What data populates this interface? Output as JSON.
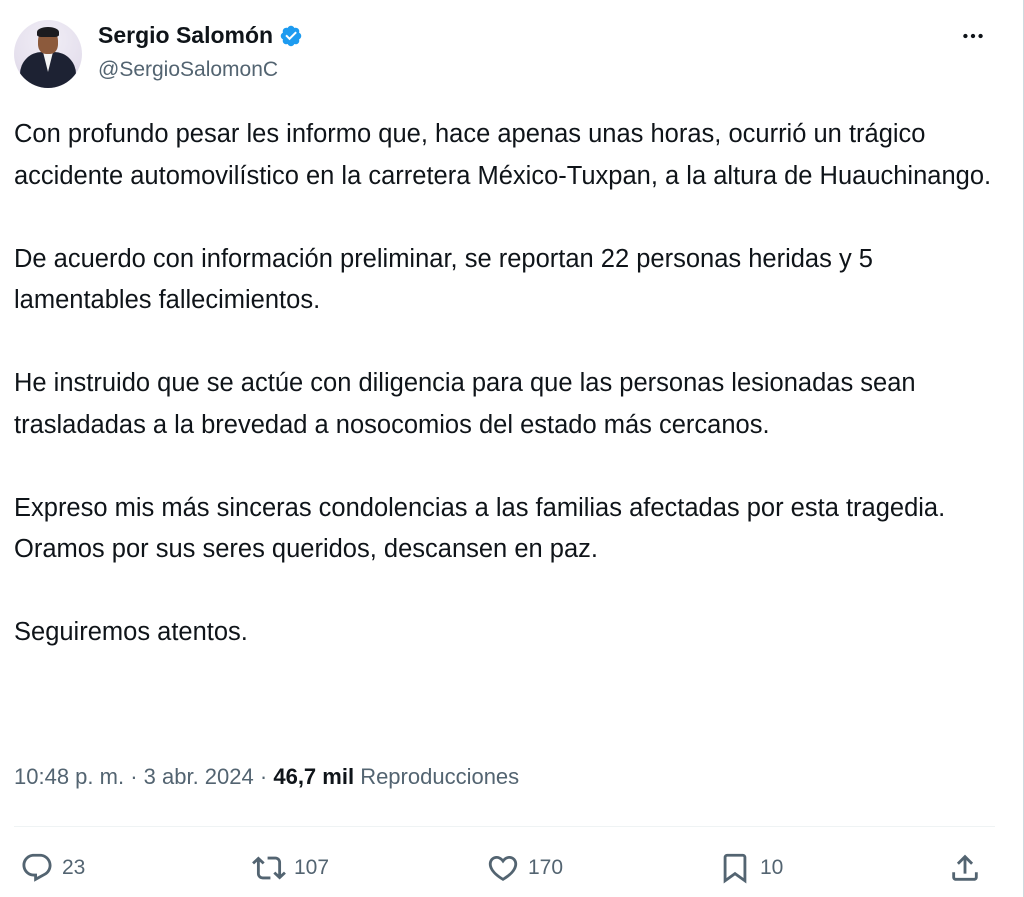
{
  "user": {
    "display_name": "Sergio Salomón",
    "handle": "@SergioSalomonC",
    "verified": true
  },
  "tweet": {
    "paragraphs": [
      "Con profundo pesar les informo que, hace apenas unas horas, ocurrió un trágico accidente automovilístico en la carretera México-Tuxpan, a la altura de Huauchinango.",
      "De acuerdo con información preliminar, se reportan 22 personas heridas y 5 lamentables fallecimientos.",
      "He instruido que se actúe con diligencia para que las personas lesionadas sean trasladadas a la brevedad a nosocomios del estado más cercanos.",
      "Expreso mis más sinceras condolencias a las familias afectadas por esta tragedia. Oramos por sus seres queridos, descansen en paz.",
      "Seguiremos atentos."
    ]
  },
  "meta": {
    "time": "10:48 p. m.",
    "separator": "·",
    "date": "3 abr. 2024",
    "views_count": "46,7 mil",
    "views_label": "Reproducciones"
  },
  "actions": {
    "replies": "23",
    "reposts": "107",
    "likes": "170",
    "bookmarks": "10"
  },
  "icons": {
    "verified": "verified-badge-icon",
    "more": "more-options-icon",
    "reply": "reply-icon",
    "repost": "repost-icon",
    "like": "heart-icon",
    "bookmark": "bookmark-icon",
    "share": "share-icon"
  },
  "colors": {
    "text_primary": "#0f1419",
    "text_secondary": "#536471",
    "verified_blue": "#1d9bf0",
    "divider": "#eff3f4"
  }
}
